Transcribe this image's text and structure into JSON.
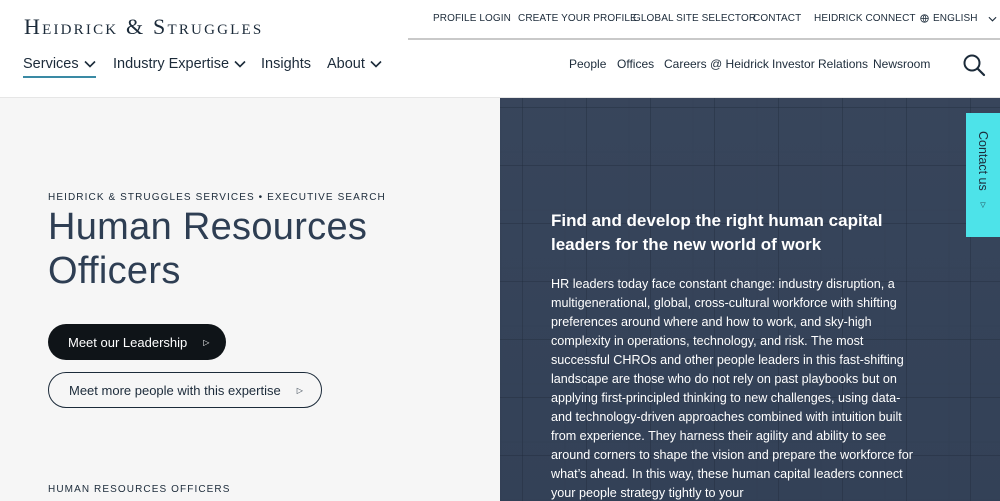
{
  "header": {
    "logo_text": "Heidrick & Struggles",
    "utility_links": [
      {
        "label": "PROFILE LOGIN"
      },
      {
        "label": "CREATE YOUR PROFILE"
      },
      {
        "label": "GLOBAL SITE SELECTOR"
      },
      {
        "label": "CONTACT"
      },
      {
        "label": "HEIDRICK CONNECT"
      }
    ],
    "language": "ENGLISH",
    "main_nav": [
      {
        "label": "Services",
        "has_dropdown": true,
        "active": true
      },
      {
        "label": "Industry Expertise",
        "has_dropdown": true
      },
      {
        "label": "Insights",
        "has_dropdown": false
      },
      {
        "label": "About",
        "has_dropdown": true
      }
    ],
    "secondary_nav": [
      {
        "label": "People"
      },
      {
        "label": "Offices"
      },
      {
        "label": "Careers @ Heidrick"
      },
      {
        "label": "Investor Relations"
      },
      {
        "label": "Newsroom"
      }
    ],
    "search_icon": "search-icon"
  },
  "hero": {
    "eyebrow": "HEIDRICK & STRUGGLES SERVICES • EXECUTIVE SEARCH",
    "title": "Human Resources Officers",
    "primary_button": "Meet our Leadership",
    "secondary_button": "Meet more people with this expertise",
    "section_label": "HUMAN RESOURCES OFFICERS"
  },
  "panel": {
    "headline": "Find and develop the right human capital leaders for the new world of work",
    "body": "HR leaders today face constant change: industry disruption, a multigenerational, global, cross-cultural workforce with shifting preferences around where and how to work, and sky-high complexity in operations, technology, and risk. The most successful CHROs and other people leaders in this fast-shifting landscape are those who do not rely on past playbooks but on applying first-principled thinking to new challenges, using data- and technology-driven approaches combined with intuition built from experience. They harness their agility and ability to see around corners to shape the vision and prepare the workforce for what’s ahead. In this way, these human capital leaders connect your people strategy tightly to your"
  },
  "contact_tab": {
    "label": "Contact us"
  },
  "colors": {
    "navy": "#1c2b3a",
    "accent_teal": "#3a8aa4",
    "contact_cyan": "#4de3e9",
    "panel_slate": "#3c4a60"
  }
}
